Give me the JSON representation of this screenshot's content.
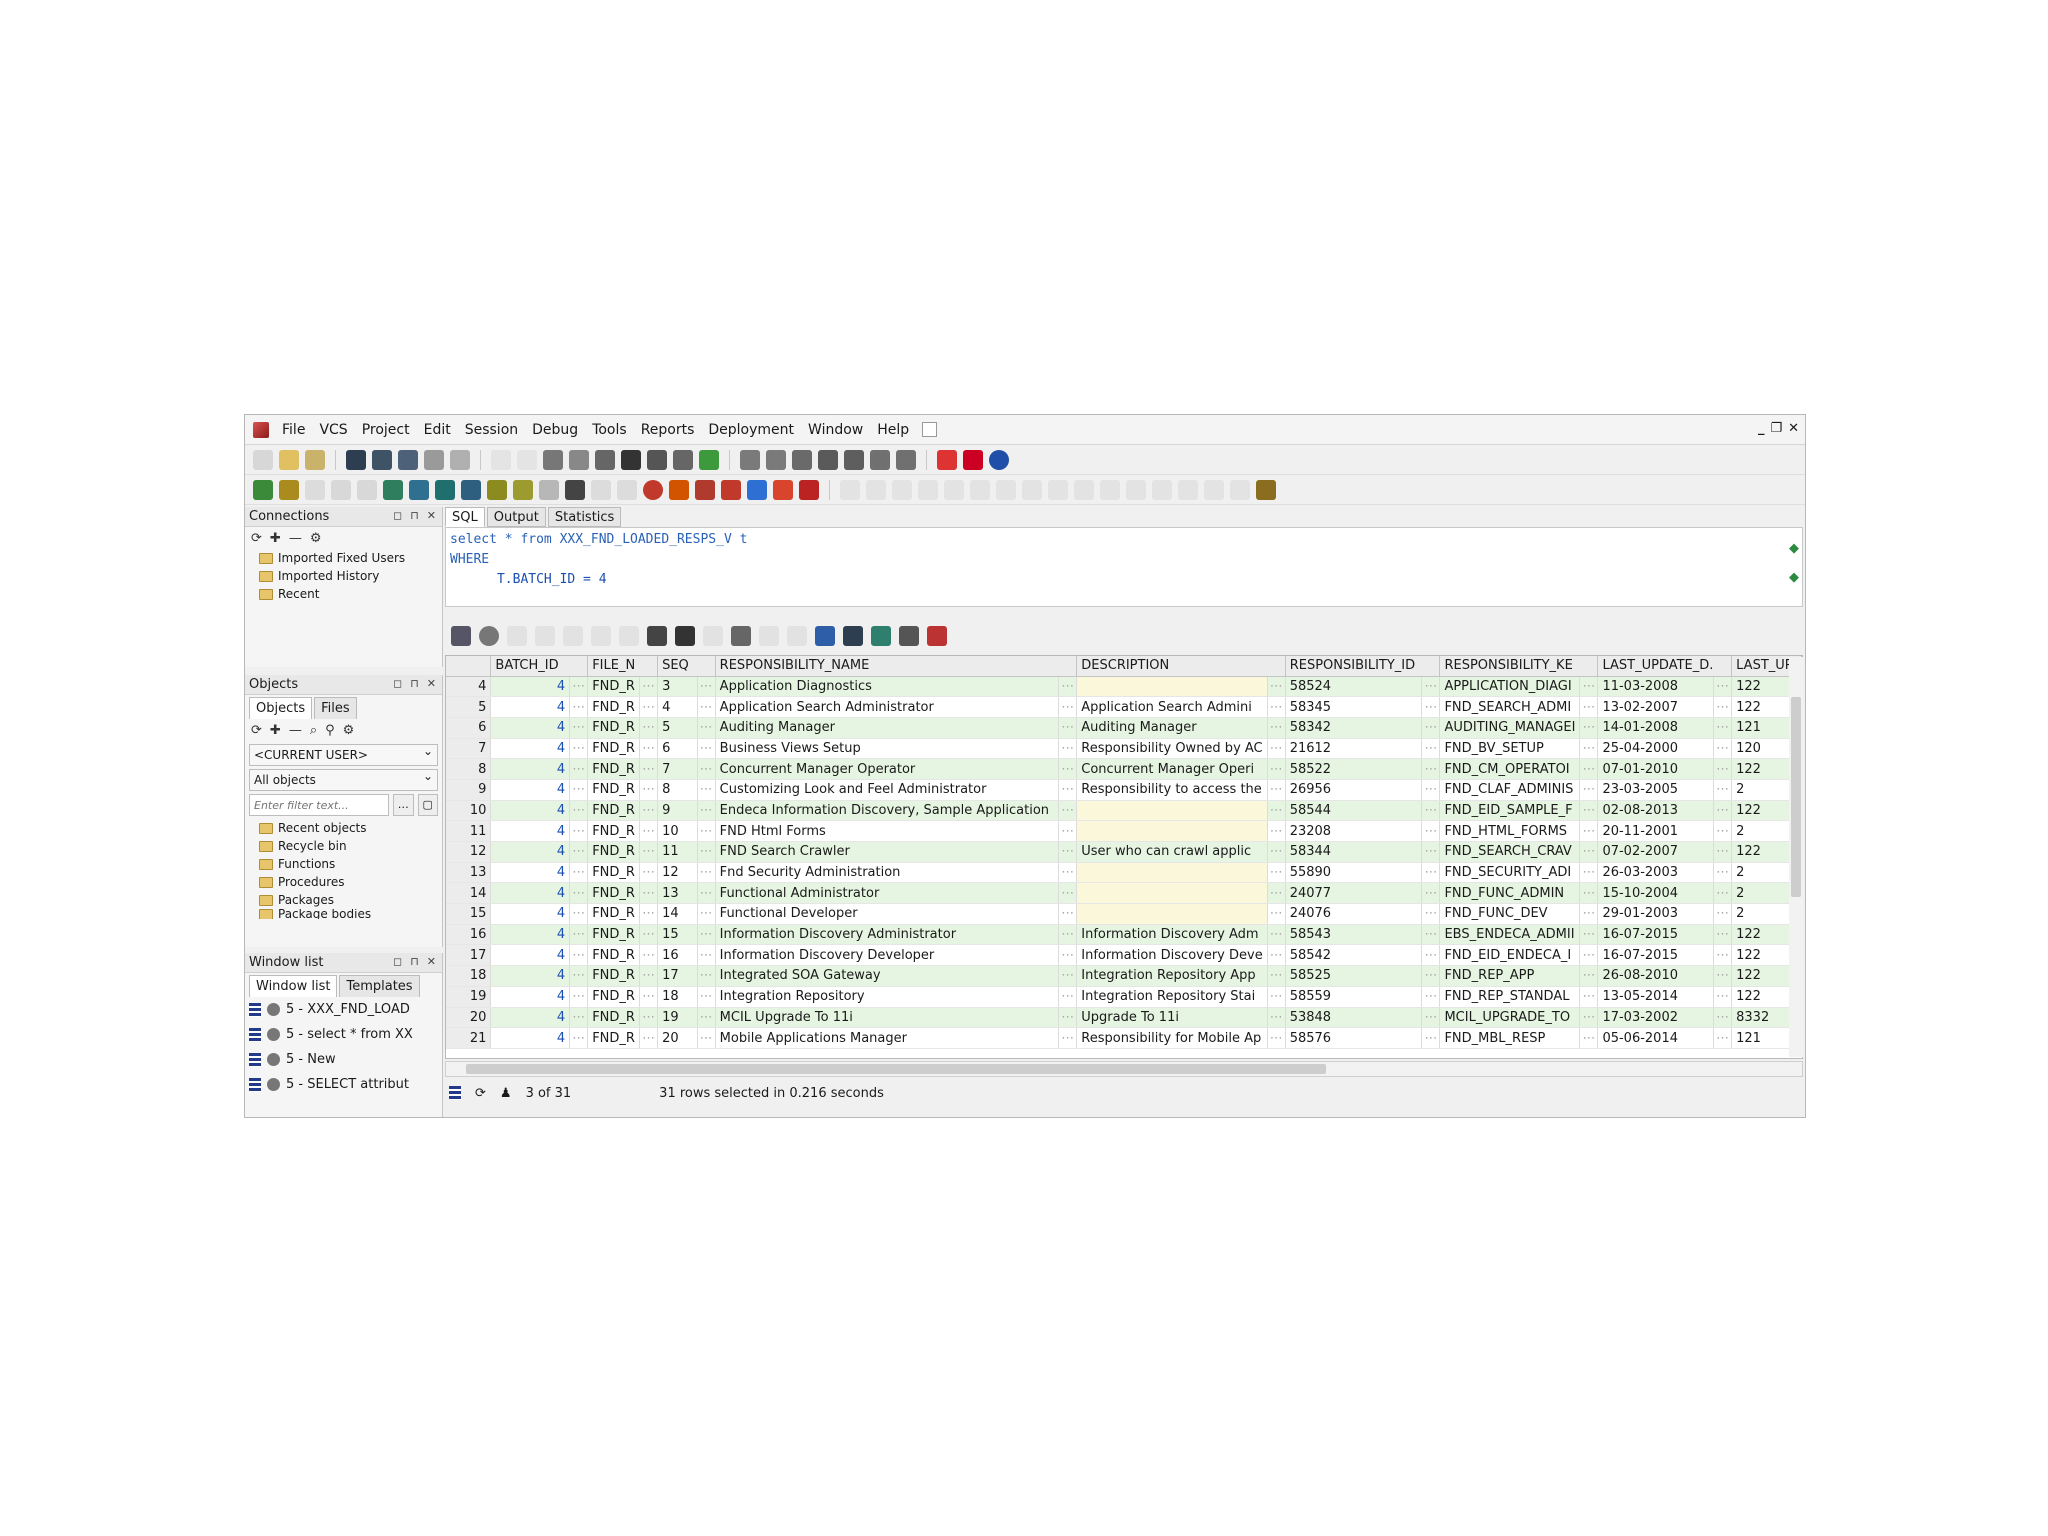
{
  "menu": [
    "File",
    "VCS",
    "Project",
    "Edit",
    "Session",
    "Debug",
    "Tools",
    "Reports",
    "Deployment",
    "Window",
    "Help"
  ],
  "connections": {
    "title": "Connections",
    "items": [
      "Imported Fixed Users",
      "Imported History",
      "Recent"
    ]
  },
  "objects": {
    "title": "Objects",
    "tabs": [
      "Objects",
      "Files"
    ],
    "user_select": "<CURRENT USER>",
    "type_select": "All objects",
    "filter_placeholder": "Enter filter text...",
    "items": [
      "Recent objects",
      "Recycle bin",
      "Functions",
      "Procedures",
      "Packages",
      "Package bodies"
    ]
  },
  "window_list": {
    "title": "Window list",
    "tabs": [
      "Window list",
      "Templates"
    ],
    "items": [
      "5 - XXX_FND_LOAD",
      "5 - select * from XX",
      "5 - New",
      "5 - SELECT attribut"
    ]
  },
  "editor": {
    "tabs": [
      "SQL",
      "Output",
      "Statistics"
    ],
    "line1_kw1": "select",
    "line1_rest": " * from XXX_FND_LOADED_RESPS_V t",
    "line2_kw": "WHERE",
    "line3": "      T.BATCH_ID = 4"
  },
  "grid": {
    "columns": [
      "BATCH_ID",
      "FILE_N",
      "SEQ",
      "RESPONSIBILITY_NAME",
      "DESCRIPTION",
      "RESPONSIBILITY_ID",
      "RESPONSIBILITY_KE",
      "LAST_UPDATE_D.",
      "LAST_UPI"
    ],
    "rows": [
      {
        "rn": "4",
        "batch": "4",
        "file": "FND_R",
        "seq": "3",
        "name": "Application Diagnostics",
        "desc": "",
        "rid": "58524",
        "key": "APPLICATION_DIAGI",
        "date": "11-03-2008",
        "upd": "122"
      },
      {
        "rn": "5",
        "batch": "4",
        "file": "FND_R",
        "seq": "4",
        "name": "Application Search Administrator",
        "desc": "Application Search Admini",
        "rid": "58345",
        "key": "FND_SEARCH_ADMI",
        "date": "13-02-2007",
        "upd": "122"
      },
      {
        "rn": "6",
        "batch": "4",
        "file": "FND_R",
        "seq": "5",
        "name": "Auditing Manager",
        "desc": "Auditing Manager",
        "rid": "58342",
        "key": "AUDITING_MANAGEI",
        "date": "14-01-2008",
        "upd": "121"
      },
      {
        "rn": "7",
        "batch": "4",
        "file": "FND_R",
        "seq": "6",
        "name": "Business Views Setup",
        "desc": "Responsibility Owned by AC",
        "rid": "21612",
        "key": "FND_BV_SETUP",
        "date": "25-04-2000",
        "upd": "120"
      },
      {
        "rn": "8",
        "batch": "4",
        "file": "FND_R",
        "seq": "7",
        "name": "Concurrent Manager Operator",
        "desc": "Concurrent Manager Operi",
        "rid": "58522",
        "key": "FND_CM_OPERATOI",
        "date": "07-01-2010",
        "upd": "122"
      },
      {
        "rn": "9",
        "batch": "4",
        "file": "FND_R",
        "seq": "8",
        "name": "Customizing Look and Feel Administrator",
        "desc": "Responsibility to access the",
        "rid": "26956",
        "key": "FND_CLAF_ADMINIS",
        "date": "23-03-2005",
        "upd": "2"
      },
      {
        "rn": "10",
        "batch": "4",
        "file": "FND_R",
        "seq": "9",
        "name": "Endeca Information Discovery, Sample Application",
        "desc": "",
        "rid": "58544",
        "key": "FND_EID_SAMPLE_F",
        "date": "02-08-2013",
        "upd": "122"
      },
      {
        "rn": "11",
        "batch": "4",
        "file": "FND_R",
        "seq": "10",
        "name": "FND Html Forms",
        "desc": "",
        "rid": "23208",
        "key": "FND_HTML_FORMS",
        "date": "20-11-2001",
        "upd": "2"
      },
      {
        "rn": "12",
        "batch": "4",
        "file": "FND_R",
        "seq": "11",
        "name": "FND Search Crawler",
        "desc": "User who can crawl applic",
        "rid": "58344",
        "key": "FND_SEARCH_CRAV",
        "date": "07-02-2007",
        "upd": "122"
      },
      {
        "rn": "13",
        "batch": "4",
        "file": "FND_R",
        "seq": "12",
        "name": "Fnd Security Administration",
        "desc": "",
        "rid": "55890",
        "key": "FND_SECURITY_ADI",
        "date": "26-03-2003",
        "upd": "2"
      },
      {
        "rn": "14",
        "batch": "4",
        "file": "FND_R",
        "seq": "13",
        "name": "Functional Administrator",
        "desc": "",
        "rid": "24077",
        "key": "FND_FUNC_ADMIN",
        "date": "15-10-2004",
        "upd": "2"
      },
      {
        "rn": "15",
        "batch": "4",
        "file": "FND_R",
        "seq": "14",
        "name": "Functional Developer",
        "desc": "",
        "rid": "24076",
        "key": "FND_FUNC_DEV",
        "date": "29-01-2003",
        "upd": "2"
      },
      {
        "rn": "16",
        "batch": "4",
        "file": "FND_R",
        "seq": "15",
        "name": "Information Discovery Administrator",
        "desc": "Information Discovery Adm",
        "rid": "58543",
        "key": "EBS_ENDECA_ADMII",
        "date": "16-07-2015",
        "upd": "122"
      },
      {
        "rn": "17",
        "batch": "4",
        "file": "FND_R",
        "seq": "16",
        "name": "Information Discovery Developer",
        "desc": "Information Discovery Deve",
        "rid": "58542",
        "key": "FND_EID_ENDECA_I",
        "date": "16-07-2015",
        "upd": "122"
      },
      {
        "rn": "18",
        "batch": "4",
        "file": "FND_R",
        "seq": "17",
        "name": "Integrated SOA Gateway",
        "desc": "Integration Repository App",
        "rid": "58525",
        "key": "FND_REP_APP",
        "date": "26-08-2010",
        "upd": "122"
      },
      {
        "rn": "19",
        "batch": "4",
        "file": "FND_R",
        "seq": "18",
        "name": "Integration Repository",
        "desc": "Integration Repository Stai",
        "rid": "58559",
        "key": "FND_REP_STANDAL",
        "date": "13-05-2014",
        "upd": "122"
      },
      {
        "rn": "20",
        "batch": "4",
        "file": "FND_R",
        "seq": "19",
        "name": "MCIL Upgrade To 11i",
        "desc": "Upgrade To 11i",
        "rid": "53848",
        "key": "MCIL_UPGRADE_TO",
        "date": "17-03-2002",
        "upd": "8332"
      },
      {
        "rn": "21",
        "batch": "4",
        "file": "FND_R",
        "seq": "20",
        "name": "Mobile Applications Manager",
        "desc": "Responsibility for Mobile Ap",
        "rid": "58576",
        "key": "FND_MBL_RESP",
        "date": "05-06-2014",
        "upd": "121"
      }
    ]
  },
  "status": {
    "position": "3 of 31",
    "message": "31 rows selected in 0.216 seconds"
  }
}
